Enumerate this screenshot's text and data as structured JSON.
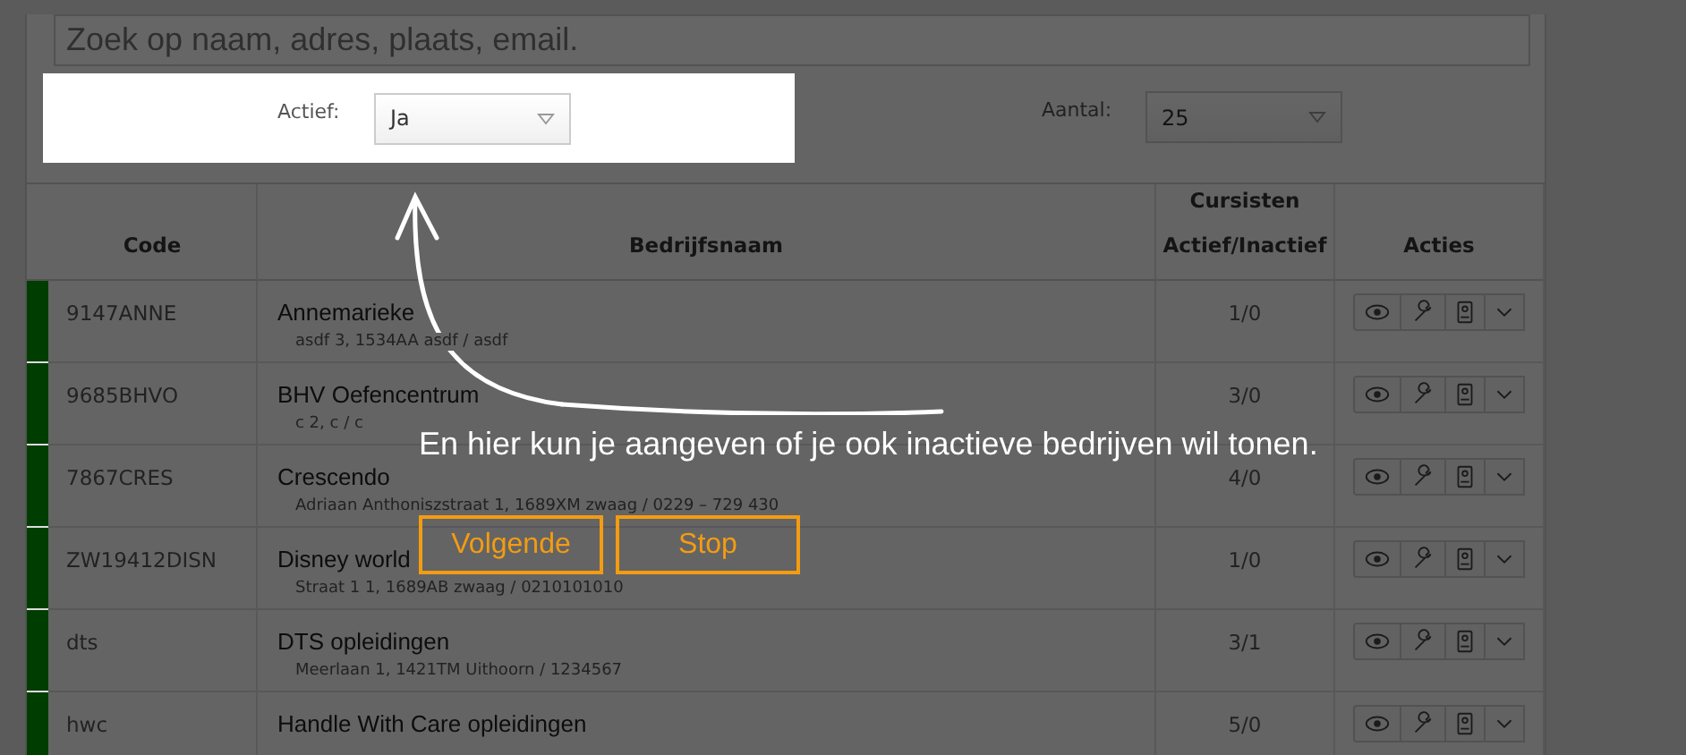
{
  "search": {
    "placeholder": "Zoek op naam, adres, plaats, email."
  },
  "filters": {
    "active": {
      "label": "Actief:",
      "value": "Ja"
    },
    "count": {
      "label": "Aantal:",
      "value": "25"
    }
  },
  "table": {
    "columns": [
      "Code",
      "Bedrijfsnaam",
      "Cursisten Actief/Inactief",
      "Acties"
    ],
    "rows": [
      {
        "color": "#003d00",
        "code": "9147ANNE",
        "name": "Annemarieke",
        "address": "asdf 3, 1534AA asdf / asdf",
        "students": "1/0"
      },
      {
        "color": "#003d00",
        "code": "9685BHVO",
        "name": "BHV Oefencentrum",
        "address": "c 2, c / c",
        "students": "3/0"
      },
      {
        "color": "#003d00",
        "code": "7867CRES",
        "name": "Crescendo",
        "address": "Adriaan Anthoniszstraat 1, 1689XM zwaag / 0229 – 729 430",
        "students": "4/0"
      },
      {
        "color": "#003d00",
        "code": "ZW19412DISN",
        "name": "Disney world",
        "address": "Straat 1 1, 1689AB zwaag / 0210101010",
        "students": "1/0"
      },
      {
        "color": "#003d00",
        "code": "dts",
        "name": "DTS opleidingen",
        "address": "Meerlaan 1, 1421TM Uithoorn / 1234567",
        "students": "3/1"
      },
      {
        "color": "#003d00",
        "code": "hwc",
        "name": "Handle With Care opleidingen",
        "students": "5/0"
      }
    ]
  },
  "tour": {
    "message": "En hier kun je aangeven of je ook inactieve bedrijven wil tonen.",
    "buttons": [
      "Volgende",
      "Stop"
    ]
  }
}
